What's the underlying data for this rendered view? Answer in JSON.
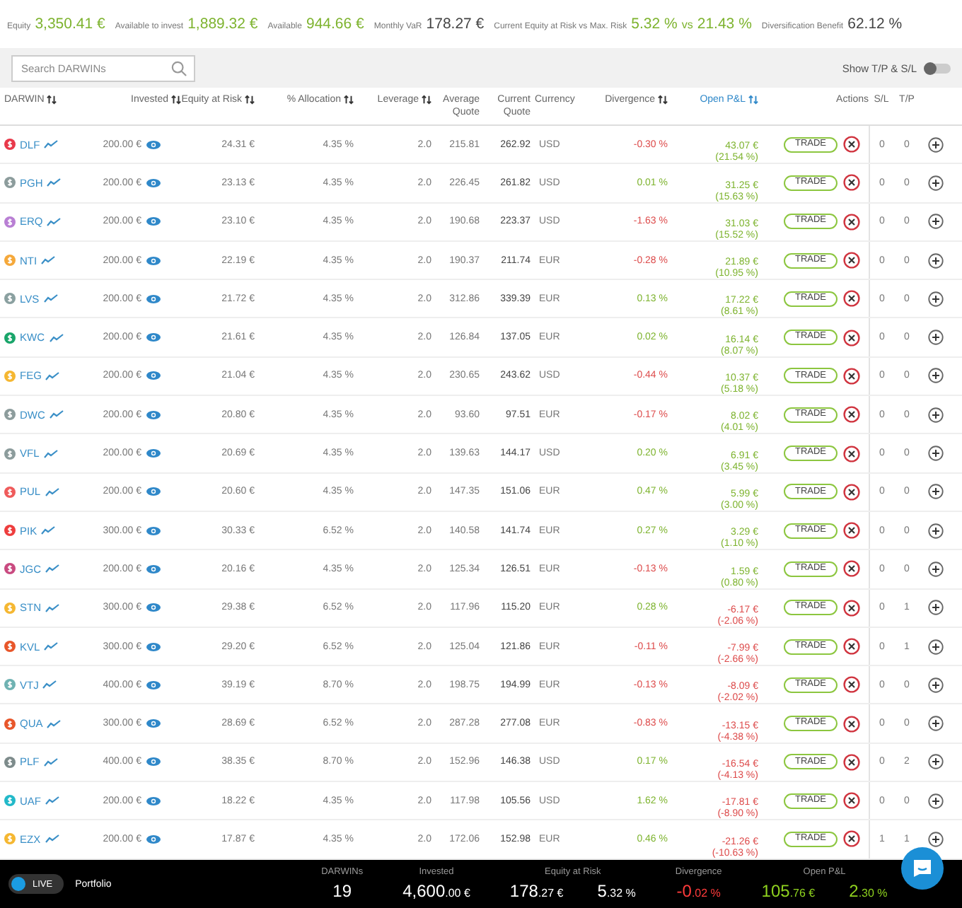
{
  "summary": [
    {
      "label": "Equity",
      "parts": [
        {
          "text": "3,350.41 €",
          "kind": "positive"
        }
      ]
    },
    {
      "label": "Available to invest",
      "parts": [
        {
          "text": "1,889.32 €",
          "kind": "positive"
        }
      ]
    },
    {
      "label": "Available",
      "parts": [
        {
          "text": "944.66 €",
          "kind": "positive"
        }
      ]
    },
    {
      "label": "Monthly VaR",
      "parts": [
        {
          "text": "178.27 €",
          "kind": "neutral"
        }
      ]
    },
    {
      "label": "Current Equity at Risk vs Max. Risk",
      "parts": [
        {
          "text": "5.32 %",
          "kind": "positive"
        },
        {
          "text": "vs",
          "kind": "joiner"
        },
        {
          "text": "21.43 %",
          "kind": "positive"
        }
      ]
    },
    {
      "label": "Diversification Benefit",
      "parts": [
        {
          "text": "62.12 %",
          "kind": "neutral"
        }
      ]
    }
  ],
  "search": {
    "placeholder": "Search DARWINs"
  },
  "toggle": {
    "label": "Show T/P & S/L",
    "on": false
  },
  "columns": [
    {
      "label": "DARWIN",
      "sortable": true,
      "active": false
    },
    {
      "label": "Invested",
      "sortable": true,
      "active": false
    },
    {
      "label": "Equity at Risk",
      "sortable": true,
      "active": false
    },
    {
      "label": "% Allocation",
      "sortable": true,
      "active": false
    },
    {
      "label": "Leverage",
      "sortable": true,
      "active": false
    },
    {
      "label": "Average Quote",
      "sortable": false,
      "active": false
    },
    {
      "label": "Current Quote",
      "sortable": false,
      "active": false
    },
    {
      "label": "Currency",
      "sortable": false,
      "active": false
    },
    {
      "label": "Divergence",
      "sortable": true,
      "active": false
    },
    {
      "label": "Open P&L",
      "sortable": true,
      "active": true
    },
    {
      "label": "Actions",
      "sortable": false,
      "active": false
    },
    {
      "label": "S/L",
      "sortable": false,
      "active": false
    },
    {
      "label": "T/P",
      "sortable": false,
      "active": false
    }
  ],
  "rows": [
    {
      "darwin": "DLF",
      "color": "#e8394a",
      "invested": "200.00 €",
      "equity_at_risk": "24.31 €",
      "allocation": "4.35 %",
      "leverage": "2.0",
      "average_quote": "215.81",
      "current_quote": "262.92",
      "currency": "USD",
      "divergence": "-0.30 %",
      "divergence_positive": false,
      "open_pnl": "43.07 €",
      "open_pnl_percent": "(21.54 %)",
      "pnl_positive": true,
      "trade_label": "TRADE",
      "sl": "0",
      "tp": "0"
    },
    {
      "darwin": "PGH",
      "color": "#8c9c9c",
      "invested": "200.00 €",
      "equity_at_risk": "23.13 €",
      "allocation": "4.35 %",
      "leverage": "2.0",
      "average_quote": "226.45",
      "current_quote": "261.82",
      "currency": "USD",
      "divergence": "0.01 %",
      "divergence_positive": true,
      "open_pnl": "31.25 €",
      "open_pnl_percent": "(15.63 %)",
      "pnl_positive": true,
      "trade_label": "TRADE",
      "sl": "0",
      "tp": "0"
    },
    {
      "darwin": "ERQ",
      "color": "#b97fd4",
      "invested": "200.00 €",
      "equity_at_risk": "23.10 €",
      "allocation": "4.35 %",
      "leverage": "2.0",
      "average_quote": "190.68",
      "current_quote": "223.37",
      "currency": "USD",
      "divergence": "-1.63 %",
      "divergence_positive": false,
      "open_pnl": "31.03 €",
      "open_pnl_percent": "(15.52 %)",
      "pnl_positive": true,
      "trade_label": "TRADE",
      "sl": "0",
      "tp": "0"
    },
    {
      "darwin": "NTI",
      "color": "#f5a83a",
      "invested": "200.00 €",
      "equity_at_risk": "22.19 €",
      "allocation": "4.35 %",
      "leverage": "2.0",
      "average_quote": "190.37",
      "current_quote": "211.74",
      "currency": "EUR",
      "divergence": "-0.28 %",
      "divergence_positive": false,
      "open_pnl": "21.89 €",
      "open_pnl_percent": "(10.95 %)",
      "pnl_positive": true,
      "trade_label": "TRADE",
      "sl": "0",
      "tp": "0"
    },
    {
      "darwin": "LVS",
      "color": "#8aa0a0",
      "invested": "200.00 €",
      "equity_at_risk": "21.72 €",
      "allocation": "4.35 %",
      "leverage": "2.0",
      "average_quote": "312.86",
      "current_quote": "339.39",
      "currency": "EUR",
      "divergence": "0.13 %",
      "divergence_positive": true,
      "open_pnl": "17.22 €",
      "open_pnl_percent": "(8.61 %)",
      "pnl_positive": true,
      "trade_label": "TRADE",
      "sl": "0",
      "tp": "0"
    },
    {
      "darwin": "KWC",
      "color": "#19a56a",
      "invested": "200.00 €",
      "equity_at_risk": "21.61 €",
      "allocation": "4.35 %",
      "leverage": "2.0",
      "average_quote": "126.84",
      "current_quote": "137.05",
      "currency": "EUR",
      "divergence": "0.02 %",
      "divergence_positive": true,
      "open_pnl": "16.14 €",
      "open_pnl_percent": "(8.07 %)",
      "pnl_positive": true,
      "trade_label": "TRADE",
      "sl": "0",
      "tp": "0"
    },
    {
      "darwin": "FEG",
      "color": "#f5b731",
      "invested": "200.00 €",
      "equity_at_risk": "21.04 €",
      "allocation": "4.35 %",
      "leverage": "2.0",
      "average_quote": "230.65",
      "current_quote": "243.62",
      "currency": "USD",
      "divergence": "-0.44 %",
      "divergence_positive": false,
      "open_pnl": "10.37 €",
      "open_pnl_percent": "(5.18 %)",
      "pnl_positive": true,
      "trade_label": "TRADE",
      "sl": "0",
      "tp": "0"
    },
    {
      "darwin": "DWC",
      "color": "#8c9c9c",
      "invested": "200.00 €",
      "equity_at_risk": "20.80 €",
      "allocation": "4.35 %",
      "leverage": "2.0",
      "average_quote": "93.60",
      "current_quote": "97.51",
      "currency": "EUR",
      "divergence": "-0.17 %",
      "divergence_positive": false,
      "open_pnl": "8.02 €",
      "open_pnl_percent": "(4.01 %)",
      "pnl_positive": true,
      "trade_label": "TRADE",
      "sl": "0",
      "tp": "0"
    },
    {
      "darwin": "VFL",
      "color": "#8c9c9c",
      "invested": "200.00 €",
      "equity_at_risk": "20.69 €",
      "allocation": "4.35 %",
      "leverage": "2.0",
      "average_quote": "139.63",
      "current_quote": "144.17",
      "currency": "USD",
      "divergence": "0.20 %",
      "divergence_positive": true,
      "open_pnl": "6.91 €",
      "open_pnl_percent": "(3.45 %)",
      "pnl_positive": true,
      "trade_label": "TRADE",
      "sl": "0",
      "tp": "0"
    },
    {
      "darwin": "PUL",
      "color": "#ef5b5b",
      "invested": "200.00 €",
      "equity_at_risk": "20.60 €",
      "allocation": "4.35 %",
      "leverage": "2.0",
      "average_quote": "147.35",
      "current_quote": "151.06",
      "currency": "EUR",
      "divergence": "0.47 %",
      "divergence_positive": true,
      "open_pnl": "5.99 €",
      "open_pnl_percent": "(3.00 %)",
      "pnl_positive": true,
      "trade_label": "TRADE",
      "sl": "0",
      "tp": "0"
    },
    {
      "darwin": "PIK",
      "color": "#ee3d3d",
      "invested": "300.00 €",
      "equity_at_risk": "30.33 €",
      "allocation": "6.52 %",
      "leverage": "2.0",
      "average_quote": "140.58",
      "current_quote": "141.74",
      "currency": "EUR",
      "divergence": "0.27 %",
      "divergence_positive": true,
      "open_pnl": "3.29 €",
      "open_pnl_percent": "(1.10 %)",
      "pnl_positive": true,
      "trade_label": "TRADE",
      "sl": "0",
      "tp": "0"
    },
    {
      "darwin": "JGC",
      "color": "#c94a80",
      "invested": "200.00 €",
      "equity_at_risk": "20.16 €",
      "allocation": "4.35 %",
      "leverage": "2.0",
      "average_quote": "125.34",
      "current_quote": "126.51",
      "currency": "EUR",
      "divergence": "-0.13 %",
      "divergence_positive": false,
      "open_pnl": "1.59 €",
      "open_pnl_percent": "(0.80 %)",
      "pnl_positive": true,
      "trade_label": "TRADE",
      "sl": "0",
      "tp": "0"
    },
    {
      "darwin": "STN",
      "color": "#f5b731",
      "invested": "300.00 €",
      "equity_at_risk": "29.38 €",
      "allocation": "6.52 %",
      "leverage": "2.0",
      "average_quote": "117.96",
      "current_quote": "115.20",
      "currency": "EUR",
      "divergence": "0.28 %",
      "divergence_positive": true,
      "open_pnl": "-6.17 €",
      "open_pnl_percent": "(-2.06 %)",
      "pnl_positive": false,
      "trade_label": "TRADE",
      "sl": "0",
      "tp": "1"
    },
    {
      "darwin": "KVL",
      "color": "#e8562a",
      "invested": "300.00 €",
      "equity_at_risk": "29.20 €",
      "allocation": "6.52 %",
      "leverage": "2.0",
      "average_quote": "125.04",
      "current_quote": "121.86",
      "currency": "EUR",
      "divergence": "-0.11 %",
      "divergence_positive": false,
      "open_pnl": "-7.99 €",
      "open_pnl_percent": "(-2.66 %)",
      "pnl_positive": false,
      "trade_label": "TRADE",
      "sl": "0",
      "tp": "1"
    },
    {
      "darwin": "VTJ",
      "color": "#6fb2b2",
      "invested": "400.00 €",
      "equity_at_risk": "39.19 €",
      "allocation": "8.70 %",
      "leverage": "2.0",
      "average_quote": "198.75",
      "current_quote": "194.99",
      "currency": "EUR",
      "divergence": "-0.13 %",
      "divergence_positive": false,
      "open_pnl": "-8.09 €",
      "open_pnl_percent": "(-2.02 %)",
      "pnl_positive": false,
      "trade_label": "TRADE",
      "sl": "0",
      "tp": "0"
    },
    {
      "darwin": "QUA",
      "color": "#e8562a",
      "invested": "300.00 €",
      "equity_at_risk": "28.69 €",
      "allocation": "6.52 %",
      "leverage": "2.0",
      "average_quote": "287.28",
      "current_quote": "277.08",
      "currency": "EUR",
      "divergence": "-0.83 %",
      "divergence_positive": false,
      "open_pnl": "-13.15 €",
      "open_pnl_percent": "(-4.38 %)",
      "pnl_positive": false,
      "trade_label": "TRADE",
      "sl": "0",
      "tp": "0"
    },
    {
      "darwin": "PLF",
      "color": "#7d8b8b",
      "invested": "400.00 €",
      "equity_at_risk": "38.35 €",
      "allocation": "8.70 %",
      "leverage": "2.0",
      "average_quote": "152.96",
      "current_quote": "146.38",
      "currency": "USD",
      "divergence": "0.17 %",
      "divergence_positive": true,
      "open_pnl": "-16.54 €",
      "open_pnl_percent": "(-4.13 %)",
      "pnl_positive": false,
      "trade_label": "TRADE",
      "sl": "0",
      "tp": "2"
    },
    {
      "darwin": "UAF",
      "color": "#22b9c9",
      "invested": "200.00 €",
      "equity_at_risk": "18.22 €",
      "allocation": "4.35 %",
      "leverage": "2.0",
      "average_quote": "117.98",
      "current_quote": "105.56",
      "currency": "USD",
      "divergence": "1.62 %",
      "divergence_positive": true,
      "open_pnl": "-17.81 €",
      "open_pnl_percent": "(-8.90 %)",
      "pnl_positive": false,
      "trade_label": "TRADE",
      "sl": "0",
      "tp": "0"
    },
    {
      "darwin": "EZX",
      "color": "#f5b731",
      "invested": "200.00 €",
      "equity_at_risk": "17.87 €",
      "allocation": "4.35 %",
      "leverage": "2.0",
      "average_quote": "172.06",
      "current_quote": "152.98",
      "currency": "EUR",
      "divergence": "0.46 %",
      "divergence_positive": true,
      "open_pnl": "-21.26 €",
      "open_pnl_percent": "(-10.63 %)",
      "pnl_positive": false,
      "trade_label": "TRADE",
      "sl": "1",
      "tp": "1"
    }
  ],
  "footer": {
    "live": {
      "label": "LIVE",
      "on": true
    },
    "mode": "Portfolio",
    "stats": [
      {
        "label": "DARWINs",
        "values": [
          {
            "main": "19",
            "kind": "neutral"
          }
        ]
      },
      {
        "label": "Invested",
        "values": [
          {
            "main": "4,600",
            "small": ".00 €",
            "kind": "neutral"
          }
        ]
      },
      {
        "label": "Equity at Risk",
        "values": [
          {
            "main": "178",
            "small": ".27 €",
            "kind": "neutral"
          },
          {
            "main": "5",
            "small": ".32 %",
            "kind": "neutral"
          }
        ]
      },
      {
        "label": "Divergence",
        "values": [
          {
            "main": "-0",
            "small": ".02 %",
            "kind": "negative"
          }
        ]
      },
      {
        "label": "Open P&L",
        "values": [
          {
            "main": "105",
            "small": ".76 €",
            "kind": "positive"
          },
          {
            "main": "2",
            "small": ".30 %",
            "kind": "positive"
          }
        ]
      }
    ]
  }
}
